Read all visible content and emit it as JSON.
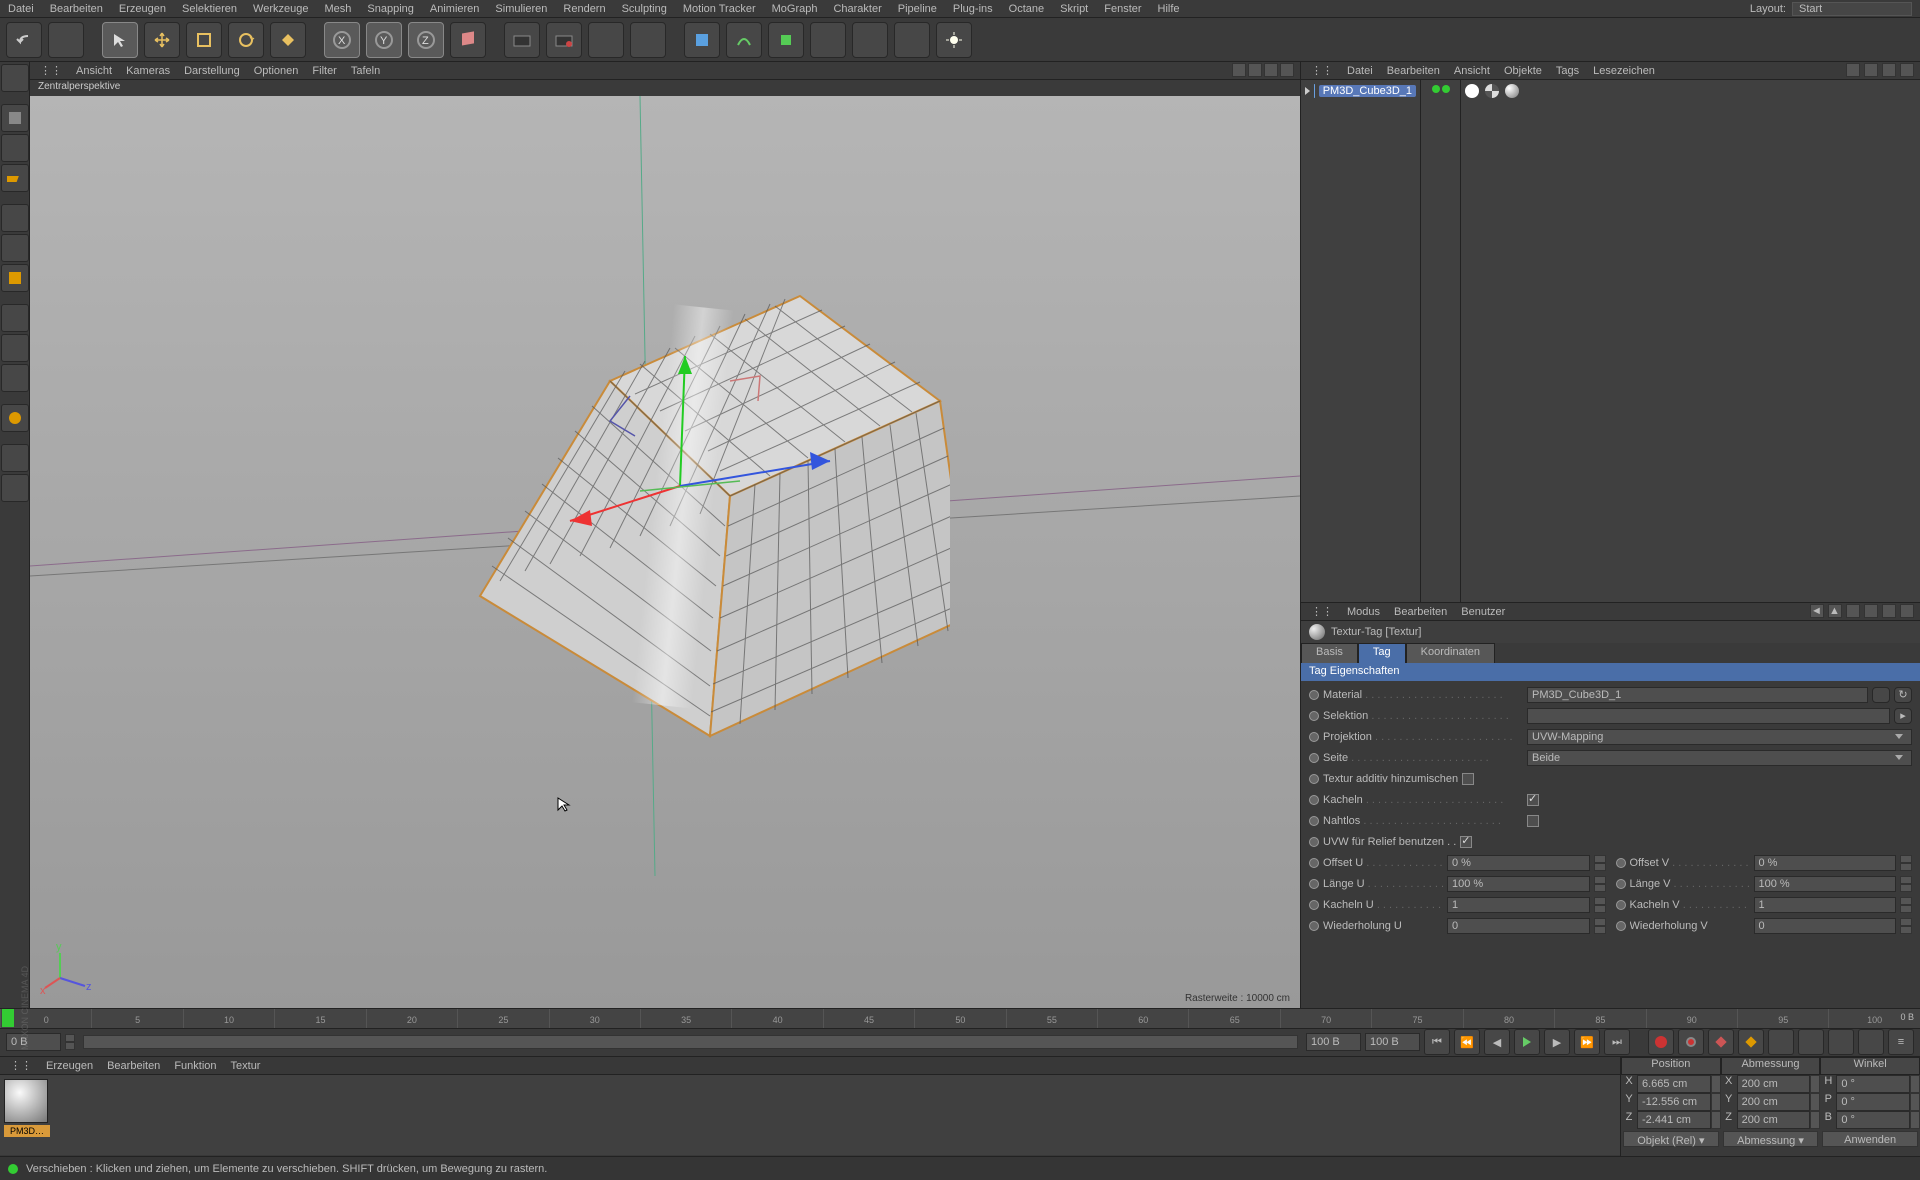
{
  "menu": {
    "items": [
      "Datei",
      "Bearbeiten",
      "Erzeugen",
      "Selektieren",
      "Werkzeuge",
      "Mesh",
      "Snapping",
      "Animieren",
      "Simulieren",
      "Rendern",
      "Sculpting",
      "Motion Tracker",
      "MoGraph",
      "Charakter",
      "Pipeline",
      "Plug-ins",
      "Octane",
      "Skript",
      "Fenster",
      "Hilfe"
    ],
    "layout_label": "Layout:",
    "layout_value": "Start"
  },
  "viewport": {
    "menus": [
      "Ansicht",
      "Kameras",
      "Darstellung",
      "Optionen",
      "Filter",
      "Tafeln"
    ],
    "projection": "Zentralperspektive",
    "raster": "Rasterweite : 10000 cm"
  },
  "obj_panel": {
    "menus": [
      "Datei",
      "Bearbeiten",
      "Ansicht",
      "Objekte",
      "Tags",
      "Lesezeichen"
    ],
    "object_name": "PM3D_Cube3D_1"
  },
  "attr_panel": {
    "menus": [
      "Modus",
      "Bearbeiten",
      "Benutzer"
    ],
    "title": "Textur-Tag [Textur]",
    "tabs": [
      "Basis",
      "Tag",
      "Koordinaten"
    ],
    "active_tab": 1,
    "section": "Tag Eigenschaften",
    "material_label": "Material",
    "material_value": "PM3D_Cube3D_1",
    "selektion_label": "Selektion",
    "selektion_value": "",
    "projektion_label": "Projektion",
    "projektion_value": "UVW-Mapping",
    "seite_label": "Seite",
    "seite_value": "Beide",
    "additiv_label": "Textur additiv hinzumischen",
    "additiv_on": false,
    "kacheln_label": "Kacheln",
    "kacheln_on": true,
    "nahtlos_label": "Nahtlos",
    "nahtlos_on": false,
    "uvw_relief_label": "UVW für Relief benutzen",
    "uvw_relief_on": true,
    "offset_u_label": "Offset U",
    "offset_u": "0 %",
    "offset_v_label": "Offset V",
    "offset_v": "0 %",
    "laenge_u_label": "Länge U",
    "laenge_u": "100 %",
    "laenge_v_label": "Länge V",
    "laenge_v": "100 %",
    "kacheln_u_label": "Kacheln U",
    "kacheln_u": "1",
    "kacheln_v_label": "Kacheln V",
    "kacheln_v": "1",
    "wieder_u_label": "Wiederholung U",
    "wieder_u": "0",
    "wieder_v_label": "Wiederholung V",
    "wieder_v": "0"
  },
  "timeline": {
    "start": "0 B",
    "end": "0 B",
    "f1": "0 B",
    "f2": "100 B",
    "f3": "100 B",
    "ticks": [
      "0",
      "5",
      "10",
      "15",
      "20",
      "25",
      "30",
      "35",
      "40",
      "45",
      "50",
      "55",
      "60",
      "65",
      "70",
      "75",
      "80",
      "85",
      "90",
      "95",
      "100"
    ]
  },
  "mat_panel": {
    "menus": [
      "Erzeugen",
      "Bearbeiten",
      "Funktion",
      "Textur"
    ],
    "mat_name": "PM3D…"
  },
  "coords": {
    "heads": [
      "Position",
      "Abmessung",
      "Winkel"
    ],
    "x_p": "6.665 cm",
    "x_a": "200 cm",
    "x_w": "0 °",
    "y_p": "-12.556 cm",
    "y_a": "200 cm",
    "y_w": "0 °",
    "z_p": "-2.441 cm",
    "z_a": "200 cm",
    "z_w": "0 °",
    "btn1": "Objekt (Rel) ▾",
    "btn2": "Abmessung ▾",
    "btn3": "Anwenden",
    "labs": {
      "x": "X",
      "y": "Y",
      "z": "Z",
      "h": "H",
      "p": "P",
      "b": "B"
    }
  },
  "status": {
    "text": "Verschieben : Klicken und ziehen, um Elemente zu verschieben. SHIFT drücken, um Bewegung zu rastern."
  }
}
